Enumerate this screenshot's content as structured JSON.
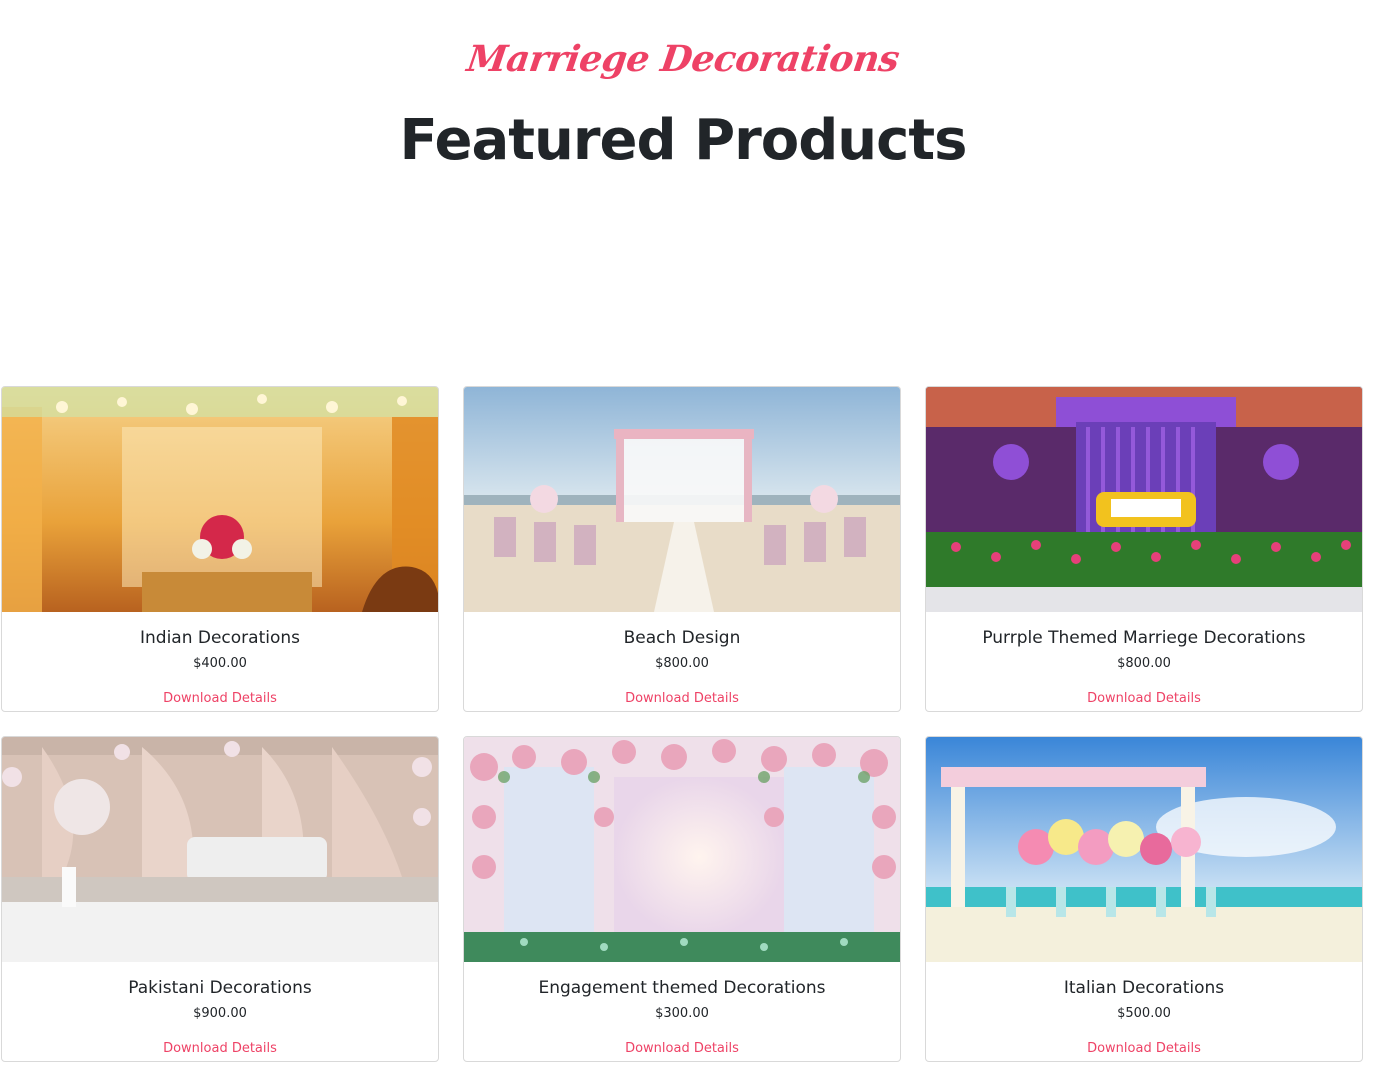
{
  "header": {
    "brand": "Marriege Decorations",
    "title": "Featured Products"
  },
  "colors": {
    "accent": "#ee4266",
    "text": "#212529",
    "border": "#d9d9d9"
  },
  "products": [
    {
      "name": "Indian Decorations",
      "price": "$400.00",
      "link_label": "Download Details",
      "image_icon": "indian-decor-photo"
    },
    {
      "name": "Beach Design",
      "price": "$800.00",
      "link_label": "Download Details",
      "image_icon": "beach-decor-photo"
    },
    {
      "name": "Purrple Themed Marriege Decorations",
      "price": "$800.00",
      "link_label": "Download Details",
      "image_icon": "purple-decor-photo"
    },
    {
      "name": "Pakistani Decorations",
      "price": "$900.00",
      "link_label": "Download Details",
      "image_icon": "pakistani-decor-photo"
    },
    {
      "name": "Engagement themed Decorations",
      "price": "$300.00",
      "link_label": "Download Details",
      "image_icon": "engagement-decor-photo"
    },
    {
      "name": "Italian Decorations",
      "price": "$500.00",
      "link_label": "Download Details",
      "image_icon": "italian-decor-photo"
    }
  ]
}
